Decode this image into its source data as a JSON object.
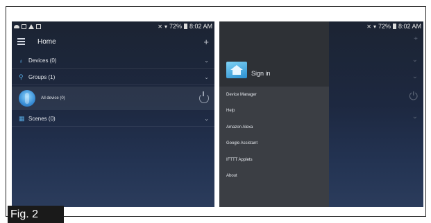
{
  "status": {
    "left_battery": "72%",
    "right_battery": "72%",
    "time": "8:02 AM"
  },
  "home": {
    "title": "Home",
    "rows": [
      {
        "label": "Devices (0)"
      },
      {
        "label": "Groups (1)"
      },
      {
        "label": "Scenes (0)"
      }
    ],
    "device": {
      "label": "All device (0)"
    }
  },
  "drawer": {
    "sign_in": "Sign in",
    "items": [
      {
        "label": "Device Manager"
      },
      {
        "label": "Help"
      },
      {
        "label": "Amazon Alexa"
      },
      {
        "label": "Google Assistant"
      },
      {
        "label": "IFTTT Applets"
      },
      {
        "label": "About"
      }
    ]
  },
  "figure_caption": "Fig. 2",
  "colors": {
    "accent": "#56a8e0",
    "drawer": "#3b3e44"
  }
}
